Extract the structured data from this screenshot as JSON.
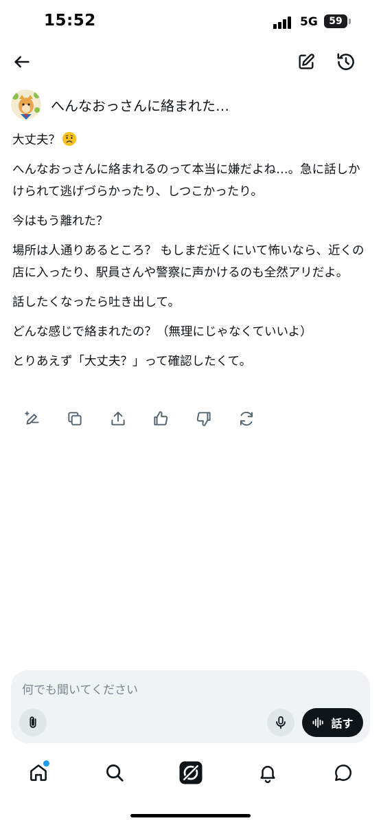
{
  "status_bar": {
    "time": "15:52",
    "network": "5G",
    "battery": "59"
  },
  "thread": {
    "title": "へんなおっさんに絡まれた…"
  },
  "message": {
    "paragraphs": [
      "大丈夫？",
      "へんなおっさんに絡まれるのって本当に嫌だよね…。急に話しかけられて逃げづらかったり、しつこかったり。",
      "今はもう離れた？",
      "場所は人通りあるところ？ もしまだ近くにいて怖いなら、近くの店に入ったり、駅員さんや警察に声かけるのも全然アリだよ。",
      "話したくなったら吐き出して。",
      "どんな感じで絡まれたの？（無理にじゃなくていいよ）",
      "とりあえず「大丈夫？」って確認したくて。"
    ],
    "emoji": "worried-face"
  },
  "actions": {
    "icons": [
      "edit-sparkle-icon",
      "copy-icon",
      "share-icon",
      "thumbs-up-icon",
      "thumbs-down-icon",
      "regenerate-icon"
    ]
  },
  "composer": {
    "placeholder": "何でも聞いてください",
    "value": "",
    "speak_label": "話す"
  },
  "bottom_nav": {
    "items": [
      "home-icon",
      "search-icon",
      "grok-icon",
      "notifications-icon",
      "messages-icon"
    ],
    "notification_dot_color": "#1d9bf0"
  }
}
